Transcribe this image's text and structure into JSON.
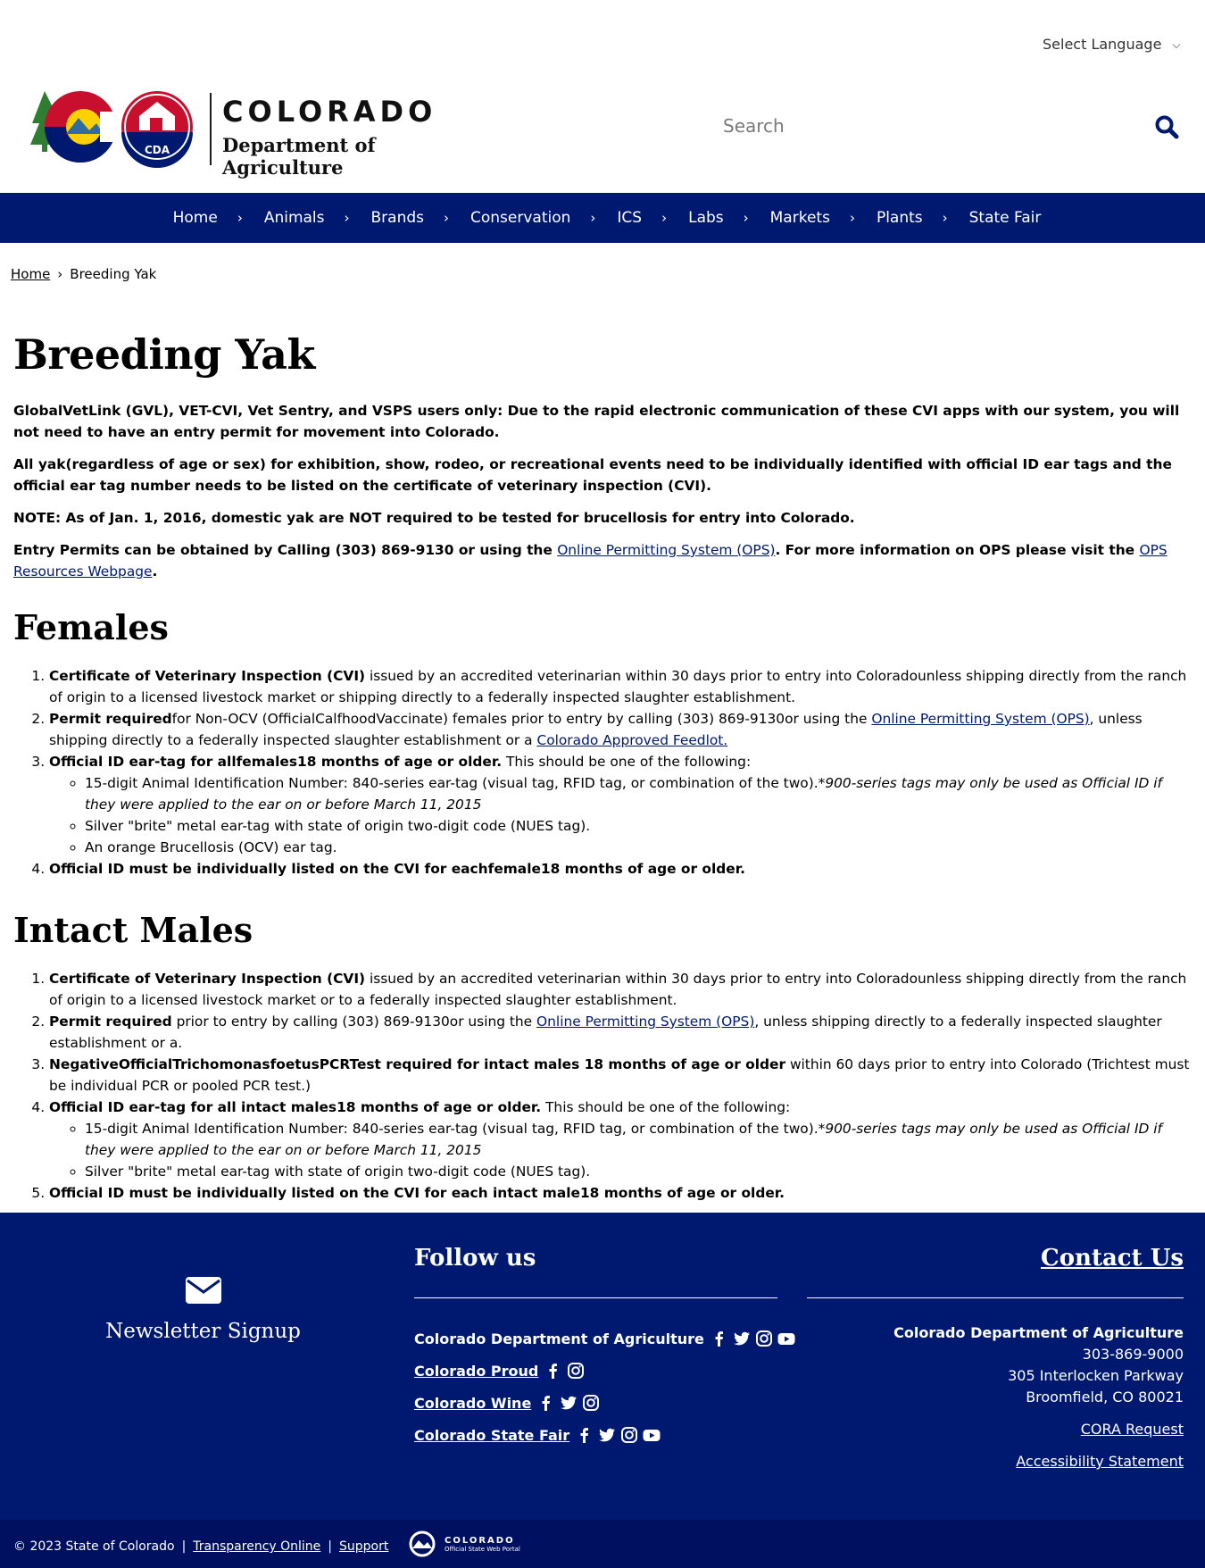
{
  "language": {
    "label": "Select Language"
  },
  "logo": {
    "state": "COLORADO",
    "dept": "Department of Agriculture",
    "badge": "CDA"
  },
  "search": {
    "placeholder": "Search"
  },
  "nav": [
    "Home",
    "Animals",
    "Brands",
    "Conservation",
    "ICS",
    "Labs",
    "Markets",
    "Plants",
    "State Fair"
  ],
  "breadcrumb": {
    "home": "Home",
    "current": "Breeding Yak"
  },
  "page": {
    "title": "Breeding Yak",
    "intro1": "GlobalVetLink (GVL), VET-CVI, Vet Sentry, and VSPS users only: Due to the rapid electronic communication of these CVI apps with our system, you will not need to have an entry permit for movement into Colorado.",
    "intro2": "All yak(regardless of age or sex) for exhibition, show, rodeo, or recreational events need to be individually identified with official ID ear tags and the official ear tag number needs to be listed on the certificate of veterinary inspection (CVI).",
    "note": "NOTE: As of Jan. 1, 2016, domestic yak are NOT required to be tested for brucellosis for entry into Colorado.",
    "permits_pre": "Entry Permits can be obtained by Calling (303) 869-9130 or using the ",
    "ops_link": "Online Permitting System (OPS)",
    "permits_mid": ". For more information on OPS please visit the ",
    "ops_resources": "OPS Resources Webpage",
    "permits_end": "."
  },
  "females": {
    "heading": "Females",
    "i1_bold": "Certificate of Veterinary Inspection (CVI)",
    "i1_text": " issued by an accredited veterinarian within 30 days prior to entry into Coloradounless shipping directly from the ranch of origin to a licensed livestock market or shipping directly to a federally inspected slaughter establishment.",
    "i2_bold": "Permit required",
    "i2_text": "for Non-OCV (OfficialCalfhoodVaccinate) females prior to entry by calling (303) 869-9130or using the ",
    "i2_link": "Online Permitting System (OPS)",
    "i2_text2": ", unless shipping directly to a federally inspected slaughter establishment or a ",
    "i2_link2": "Colorado Approved Feedlot.",
    "i3_bold": "Official ID ear-tag for allfemales18 months of age or older.",
    "i3_text": " This should be one of the following:",
    "sub1": "15-digit Animal Identification Number: 840-series ear-tag (visual tag, RFID tag, or combination of the two).",
    "sub1_em": "*900-series tags may only be used as Official ID if they were applied to the ear on or before March 11, 2015",
    "sub2": "Silver \"brite\" metal ear-tag with state of origin two-digit code (NUES tag).",
    "sub3": "An orange Brucellosis (OCV) ear tag.",
    "i4_bold": "Official ID must be individually listed on the CVI for eachfemale18 months of age or older."
  },
  "males": {
    "heading": "Intact Males",
    "i1_bold": "Certificate of Veterinary Inspection (CVI)",
    "i1_text": " issued by an accredited veterinarian within 30 days prior to entry into Coloradounless shipping directly from the ranch of origin to a licensed livestock market or to a federally inspected slaughter establishment.",
    "i2_bold": "Permit required",
    "i2_text": " prior to entry by calling (303) 869-9130or using the ",
    "i2_link": "Online Permitting System (OPS)",
    "i2_text2": ", unless shipping directly to a federally inspected slaughter establishment or a.",
    "i3_bold": "NegativeOfficialTrichomonasfoetusPCRTest required for intact males 18 months of age or older",
    "i3_text": "  within 60 days prior to entry into Colorado (Trichtest must be individual PCR or pooled PCR test.)",
    "i4_bold": "Official ID ear-tag for all intact males18 months of age or older.",
    "i4_text": " This should be one of the following:",
    "sub1": "15-digit Animal Identification Number: 840-series ear-tag (visual tag, RFID tag, or combination of the two).",
    "sub1_em": "*900-series tags may only be used as Official ID if they were applied to the ear on or before March 11, 2015",
    "sub2": "Silver \"brite\" metal ear-tag with state of origin two-digit code (NUES tag).",
    "i5_bold": "Official ID must be individually listed on the CVI for each intact male18 months of age or older."
  },
  "footer": {
    "newsletter": "Newsletter Signup",
    "follow_title": "Follow us",
    "social": [
      {
        "name": "Colorado Department of Agriculture",
        "icons": [
          "facebook-icon",
          "twitter-icon",
          "instagram-icon",
          "youtube-icon"
        ]
      },
      {
        "name": "Colorado Proud",
        "icons": [
          "facebook-icon",
          "instagram-icon"
        ]
      },
      {
        "name": "Colorado Wine",
        "icons": [
          "facebook-icon",
          "twitter-icon",
          "instagram-icon"
        ]
      },
      {
        "name": "Colorado State Fair",
        "icons": [
          "facebook-icon",
          "twitter-icon",
          "instagram-icon",
          "youtube-icon"
        ]
      }
    ],
    "contact_title": "Contact Us",
    "contact_name": "Colorado Department of Agriculture",
    "phone": "303-869-9000",
    "address1": "305 Interlocken Parkway",
    "address2": "Broomfield, CO 80021",
    "cora": "CORA Request",
    "accessibility": "Accessibility Statement"
  },
  "subfooter": {
    "copyright": "© 2023 State of Colorado",
    "transparency": "Transparency Online",
    "support": "Support",
    "portal_1": "COLORADO",
    "portal_2": "Official State Web Portal"
  },
  "colors": {
    "navy": "#001970",
    "link": "#001970",
    "subfooter": "#001060"
  }
}
